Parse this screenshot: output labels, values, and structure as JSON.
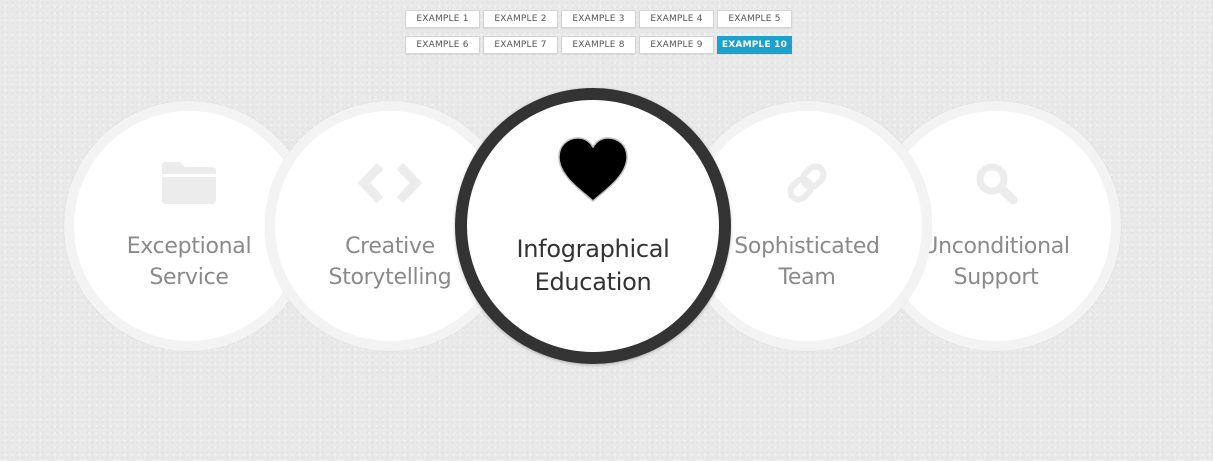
{
  "nav": {
    "row1": [
      "EXAMPLE 1",
      "EXAMPLE 2",
      "EXAMPLE 3",
      "EXAMPLE 4",
      "EXAMPLE 5"
    ],
    "row2": [
      "EXAMPLE 6",
      "EXAMPLE 7",
      "EXAMPLE 8",
      "EXAMPLE 9",
      "EXAMPLE 10"
    ],
    "active": "EXAMPLE 10",
    "active_color": "#1ba1cb"
  },
  "circles": [
    {
      "line1": "Exceptional",
      "line2": "Service",
      "icon": "folder-icon"
    },
    {
      "line1": "Creative",
      "line2": "Storytelling",
      "icon": "code-icon"
    },
    {
      "line1": "Infographical",
      "line2": "Education",
      "icon": "heart-icon",
      "active": true
    },
    {
      "line1": "Sophisticated",
      "line2": "Team",
      "icon": "link-icon"
    },
    {
      "line1": "Unconditional",
      "line2": "Support",
      "icon": "search-icon"
    }
  ],
  "colors": {
    "background": "#e9e9e9",
    "circle_fill": "#ffffff",
    "circle_ring": "#f3f3f3",
    "active_ring": "#333333",
    "inactive_text": "#8a8a8a",
    "inactive_icon": "#ececec",
    "active_text": "#333333"
  }
}
